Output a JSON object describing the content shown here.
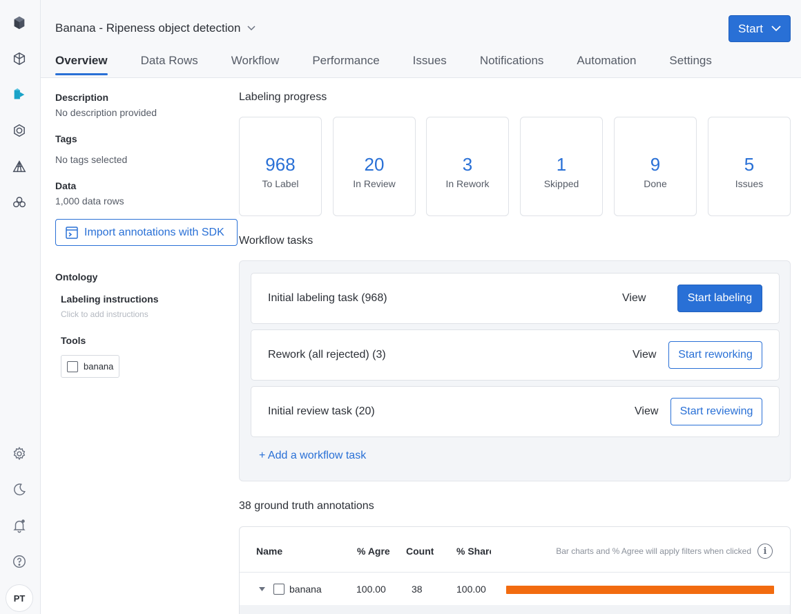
{
  "project": {
    "title": "Banana - Ripeness object detection",
    "start_label": "Start"
  },
  "tabs": [
    "Overview",
    "Data Rows",
    "Workflow",
    "Performance",
    "Issues",
    "Notifications",
    "Automation",
    "Settings"
  ],
  "user": {
    "initials": "PT"
  },
  "info": {
    "description_label": "Description",
    "description_value": "No description provided",
    "tags_label": "Tags",
    "tags_value": "No tags selected",
    "data_label": "Data",
    "data_value": "1,000 data rows",
    "sdk_button": "Import annotations with SDK",
    "ontology_label": "Ontology",
    "instructions_label": "Labeling instructions",
    "instructions_hint": "Click to add instructions",
    "tools_label": "Tools",
    "tool_name": "banana"
  },
  "progress": {
    "title": "Labeling progress",
    "stats": [
      {
        "value": "968",
        "label": "To Label"
      },
      {
        "value": "20",
        "label": "In Review"
      },
      {
        "value": "3",
        "label": "In Rework"
      },
      {
        "value": "1",
        "label": "Skipped"
      },
      {
        "value": "9",
        "label": "Done"
      },
      {
        "value": "5",
        "label": "Issues"
      }
    ]
  },
  "workflow": {
    "title": "Workflow tasks",
    "tasks": [
      {
        "name": "Initial labeling task  (968)",
        "view": "View",
        "action": "Start labeling"
      },
      {
        "name": "Rework (all rejected)  (3)",
        "view": "View",
        "action": "Start reworking"
      },
      {
        "name": "Initial review task  (20)",
        "view": "View",
        "action": "Start reviewing"
      }
    ],
    "add_label": "+ Add a workflow task"
  },
  "ground_truth": {
    "title": "38 ground truth annotations",
    "headers": {
      "name": "Name",
      "agree": "% Agree",
      "count": "Count",
      "share": "% Share"
    },
    "hint": "Bar charts and % Agree will apply filters when clicked",
    "rows": [
      {
        "name": "banana",
        "agree": "100.00",
        "count": "38",
        "share": "100.00",
        "bar_fraction": 1.0
      }
    ]
  },
  "colors": {
    "accent": "#2970d6",
    "bar": "#f26b0f"
  }
}
